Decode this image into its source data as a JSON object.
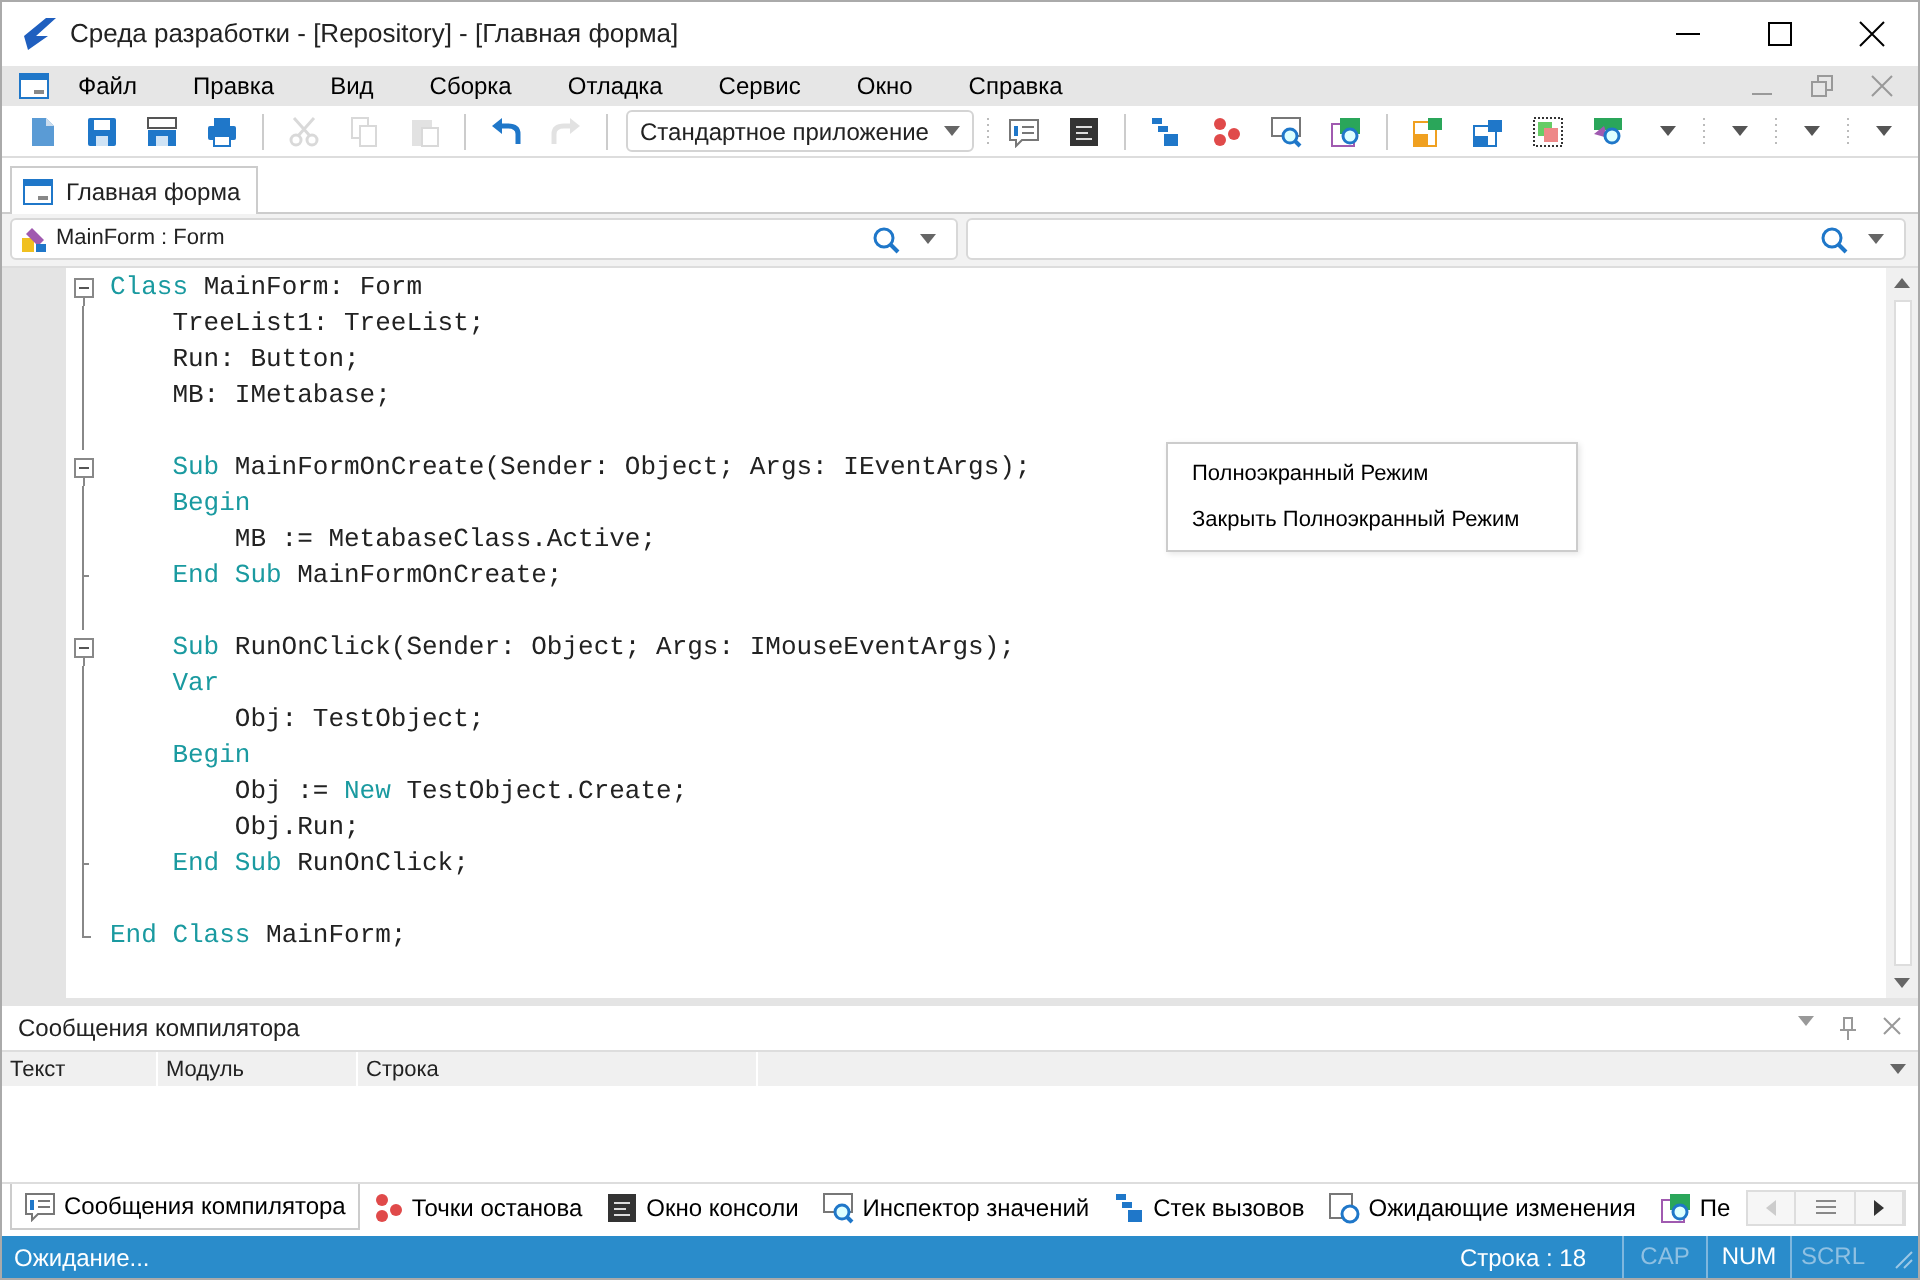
{
  "window": {
    "title": "Среда разработки - [Repository] - [Главная форма]"
  },
  "menu": [
    "Файл",
    "Правка",
    "Вид",
    "Сборка",
    "Отладка",
    "Сервис",
    "Окно",
    "Справка"
  ],
  "toolbar": [
    {
      "kind": "new",
      "disabled": false
    },
    {
      "kind": "save",
      "disabled": false
    },
    {
      "kind": "saveas",
      "disabled": false
    },
    {
      "kind": "print",
      "disabled": false
    },
    {
      "kind": "sep"
    },
    {
      "kind": "cut",
      "disabled": true
    },
    {
      "kind": "copy",
      "disabled": true
    },
    {
      "kind": "paste",
      "disabled": true
    },
    {
      "kind": "sep"
    },
    {
      "kind": "undo",
      "disabled": false
    },
    {
      "kind": "redo",
      "disabled": true
    },
    {
      "kind": "sep"
    },
    {
      "kind": "combo",
      "text": "Стандартное приложение"
    },
    {
      "kind": "grip"
    },
    {
      "kind": "messages",
      "disabled": false
    },
    {
      "kind": "console",
      "disabled": false
    },
    {
      "kind": "sep"
    },
    {
      "kind": "stack",
      "disabled": false
    },
    {
      "kind": "breakpoints",
      "disabled": false
    },
    {
      "kind": "inspect",
      "disabled": false
    },
    {
      "kind": "watch",
      "disabled": false
    },
    {
      "kind": "sep"
    },
    {
      "kind": "import",
      "disabled": false
    },
    {
      "kind": "export",
      "disabled": false
    },
    {
      "kind": "select",
      "disabled": false
    },
    {
      "kind": "find",
      "disabled": false
    },
    {
      "kind": "more"
    },
    {
      "kind": "grip"
    },
    {
      "kind": "more"
    },
    {
      "kind": "grip"
    },
    {
      "kind": "more"
    },
    {
      "kind": "grip"
    },
    {
      "kind": "more"
    }
  ],
  "document_tabs": [
    {
      "label": "Главная форма",
      "selected": true
    }
  ],
  "object_selector": {
    "value": "MainForm : Form"
  },
  "code_lines": [
    {
      "kind": "open",
      "tokens": [
        {
          "kind": "keyword",
          "text": "Class"
        },
        {
          "kind": "text",
          "text": " MainForm: Form"
        }
      ]
    },
    {
      "kind": "line",
      "tokens": [
        {
          "kind": "text",
          "text": "    TreeList1: TreeList;"
        }
      ]
    },
    {
      "kind": "line",
      "tokens": [
        {
          "kind": "text",
          "text": "    Run: Button;"
        }
      ]
    },
    {
      "kind": "line",
      "tokens": [
        {
          "kind": "text",
          "text": "    MB: IMetabase;"
        }
      ]
    },
    {
      "kind": "line"
    },
    {
      "kind": "open",
      "tokens": [
        {
          "kind": "keyword",
          "text": "    Sub"
        },
        {
          "kind": "text",
          "text": " MainFormOnCreate(Sender: Object; Args: IEventArgs);"
        }
      ]
    },
    {
      "kind": "line",
      "tokens": [
        {
          "kind": "keyword",
          "text": "    Begin"
        }
      ]
    },
    {
      "kind": "line",
      "tokens": [
        {
          "kind": "text",
          "text": "        MB := MetabaseClass.Active;"
        }
      ]
    },
    {
      "kind": "tick",
      "tokens": [
        {
          "kind": "keyword",
          "text": "    End Sub"
        },
        {
          "kind": "text",
          "text": " MainFormOnCreate;"
        }
      ]
    },
    {
      "kind": "line"
    },
    {
      "kind": "open",
      "tokens": [
        {
          "kind": "keyword",
          "text": "    Sub"
        },
        {
          "kind": "text",
          "text": " RunOnClick(Sender: Object; Args: IMouseEventArgs);"
        }
      ]
    },
    {
      "kind": "line",
      "tokens": [
        {
          "kind": "keyword",
          "text": "    Var"
        }
      ]
    },
    {
      "kind": "line",
      "tokens": [
        {
          "kind": "text",
          "text": "        Obj: TestObject;"
        }
      ]
    },
    {
      "kind": "line",
      "tokens": [
        {
          "kind": "keyword",
          "text": "    Begin"
        }
      ]
    },
    {
      "kind": "line",
      "tokens": [
        {
          "kind": "text",
          "text": "        Obj := "
        },
        {
          "kind": "keyword",
          "text": "New"
        },
        {
          "kind": "text",
          "text": " TestObject.Create;"
        }
      ]
    },
    {
      "kind": "line",
      "tokens": [
        {
          "kind": "text",
          "text": "        Obj.Run;"
        }
      ]
    },
    {
      "kind": "tick",
      "tokens": [
        {
          "kind": "keyword",
          "text": "    End Sub"
        },
        {
          "kind": "text",
          "text": " RunOnClick;"
        }
      ]
    },
    {
      "kind": "line"
    },
    {
      "kind": "end",
      "tokens": [
        {
          "kind": "keyword",
          "text": "End Class"
        },
        {
          "kind": "text",
          "text": " MainForm;"
        }
      ]
    }
  ],
  "context_menu": [
    "Полноэкранный Режим",
    "Закрыть Полноэкранный Режим"
  ],
  "compiler_panel": {
    "title": "Сообщения компилятора",
    "columns": [
      "Текст",
      "Модуль",
      "Строка"
    ]
  },
  "bottom_tabs": [
    {
      "kind": "messages",
      "label": "Сообщения компилятора",
      "selected": true
    },
    {
      "kind": "breakpoints",
      "label": "Точки останова",
      "selected": false
    },
    {
      "kind": "console",
      "label": "Окно консоли",
      "selected": false
    },
    {
      "kind": "inspect",
      "label": "Инспектор значений",
      "selected": false
    },
    {
      "kind": "stack",
      "label": "Стек вызовов",
      "selected": false
    },
    {
      "kind": "pending",
      "label": "Ожидающие изменения",
      "selected": false
    },
    {
      "kind": "watch",
      "label": "Пе",
      "selected": false
    }
  ],
  "status_bar": {
    "status": "Ожидание...",
    "position": "Строка : 18",
    "indicators": [
      {
        "text": "CAP",
        "on": false
      },
      {
        "text": "NUM",
        "on": true
      },
      {
        "text": "SCRL",
        "on": false
      }
    ]
  }
}
